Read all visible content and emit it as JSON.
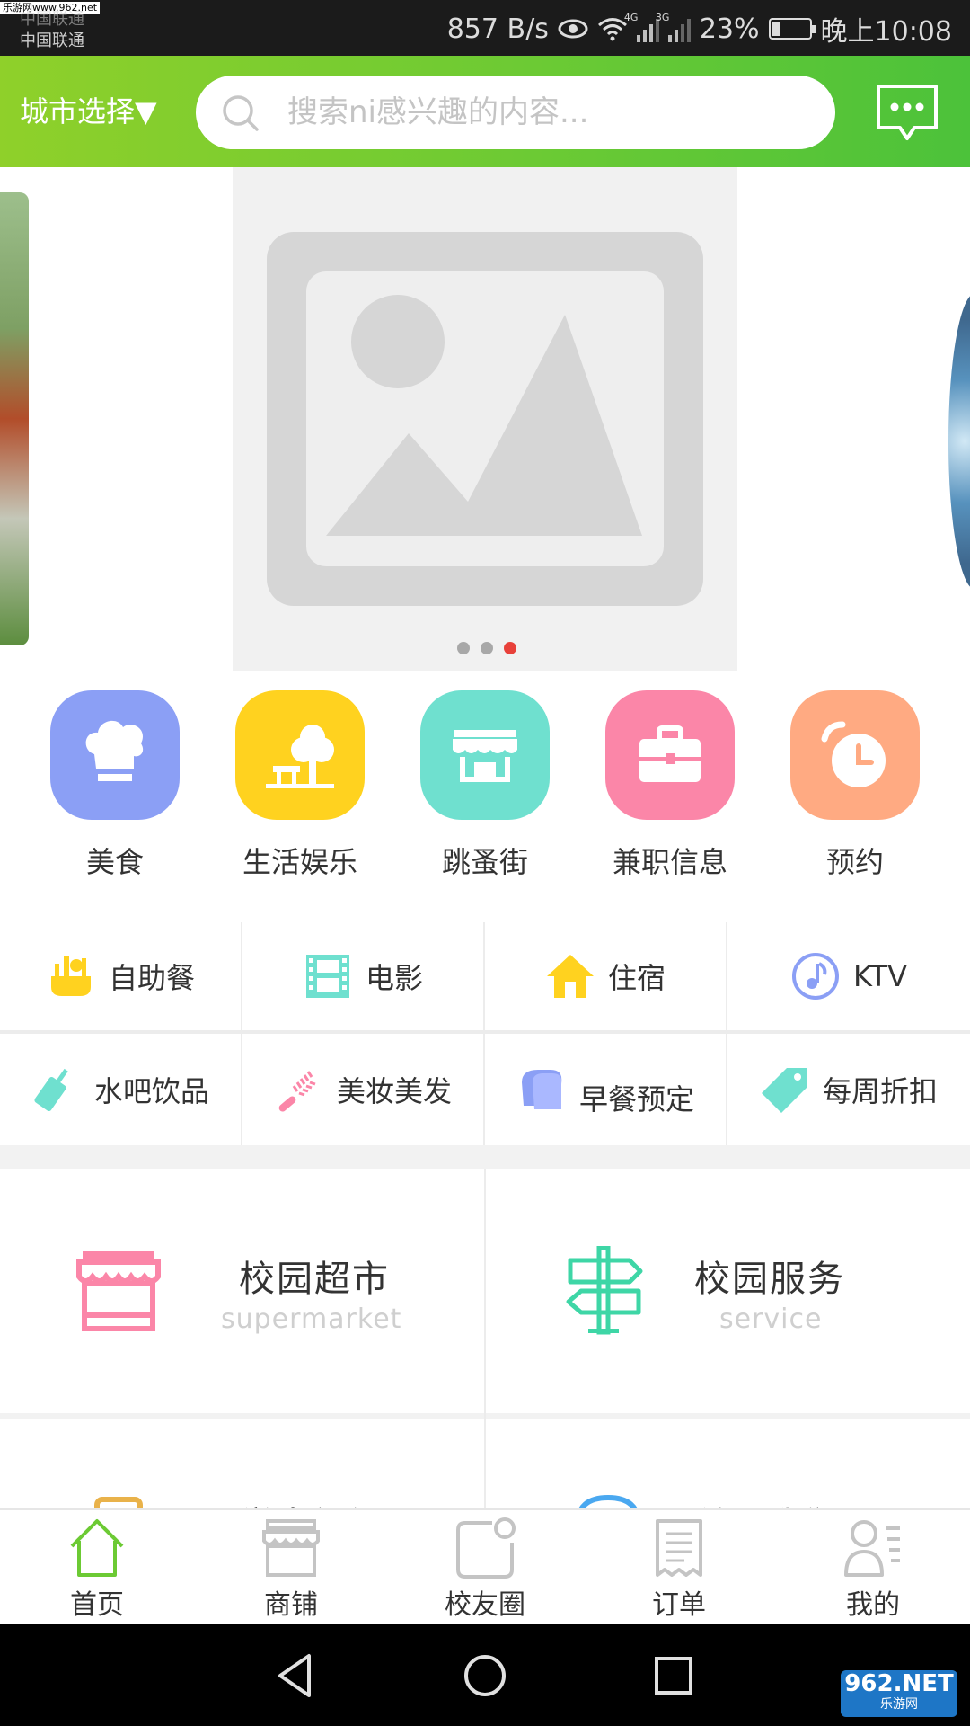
{
  "status_bar": {
    "watermark": "乐游网www.962.net",
    "carrier_1": "中国联通",
    "carrier_2": "中国联通",
    "net_speed": "857 B/s",
    "net_1": "4G",
    "net_2": "3G",
    "battery": "23%",
    "battery_level": 0.23,
    "time": "晚上10:08"
  },
  "header": {
    "city_label": "城市选择▼",
    "search_placeholder": "搜索ni感兴趣的内容...",
    "accent_color": "#6cca34"
  },
  "banner": {
    "dots": 3,
    "active_dot": 3
  },
  "categories": [
    {
      "label": "美食",
      "color": "#8b9ff5",
      "icon": "chef-hat-icon"
    },
    {
      "label": "生活娱乐",
      "color": "#ffd21f",
      "icon": "tree-bench-icon"
    },
    {
      "label": "跳蚤街",
      "color": "#6fe0cf",
      "icon": "storefront-icon"
    },
    {
      "label": "兼职信息",
      "color": "#fb86a8",
      "icon": "briefcase-icon"
    },
    {
      "label": "预约",
      "color": "#ffaa82",
      "icon": "alarm-clock-icon"
    }
  ],
  "subgrid": [
    {
      "label": "自助餐",
      "icon": "buffet-icon"
    },
    {
      "label": "电影",
      "icon": "film-icon"
    },
    {
      "label": "住宿",
      "icon": "house-icon"
    },
    {
      "label": "KTV",
      "icon": "music-note-icon"
    },
    {
      "label": "水吧饮品",
      "icon": "drink-cup-icon"
    },
    {
      "label": "美妆美发",
      "icon": "comb-icon"
    },
    {
      "label": "早餐预定",
      "icon": "bread-icon"
    },
    {
      "label": "每周折扣",
      "icon": "price-tag-icon"
    }
  ],
  "features": [
    {
      "title": "校园超市",
      "subtitle": "supermarket",
      "icon": "shop-icon"
    },
    {
      "title": "校园服务",
      "subtitle": "service",
      "icon": "signpost-icon"
    },
    {
      "title": "学生组织",
      "icon": "bag-icon"
    },
    {
      "title": "关于我们",
      "icon": "globe-icon"
    }
  ],
  "tabs": [
    {
      "label": "首页",
      "icon": "home-icon"
    },
    {
      "label": "商铺",
      "icon": "store-icon"
    },
    {
      "label": "校友圈",
      "icon": "circle-square-icon"
    },
    {
      "label": "订单",
      "icon": "receipt-icon"
    },
    {
      "label": "我的",
      "icon": "profile-icon"
    }
  ],
  "brand": {
    "line1": "962.NET",
    "line2": "乐游网"
  }
}
